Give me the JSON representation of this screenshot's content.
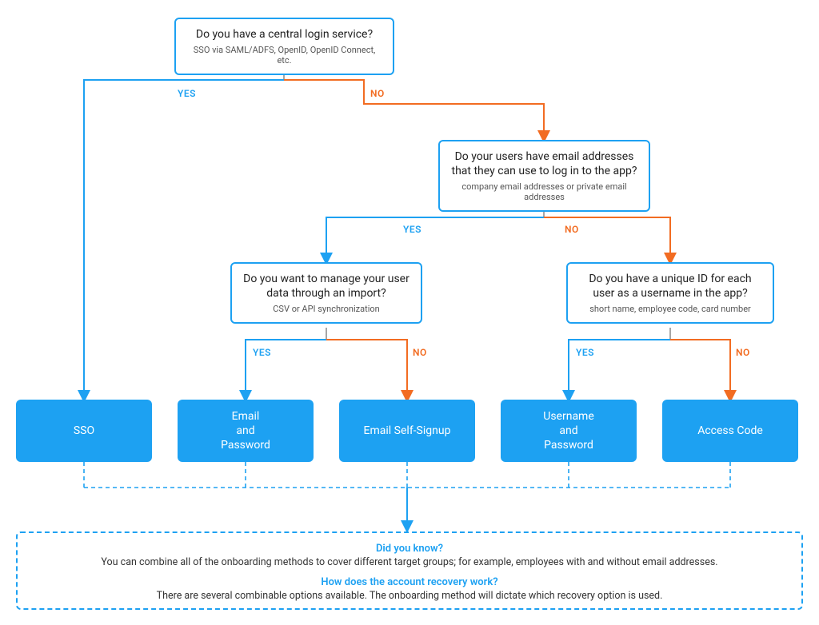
{
  "nodes": {
    "q1": {
      "question": "Do you have a central login service?",
      "sub": "SSO via SAML/ADFS, OpenID, OpenID Connect, etc."
    },
    "q2": {
      "question": "Do your users have email addresses that they can use to log in to the app?",
      "sub": "company email addresses or private email addresses"
    },
    "q3": {
      "question": "Do you want to manage your user data through an import?",
      "sub": "CSV or API synchronization"
    },
    "q4": {
      "question": "Do you have a unique ID for each user as a username in the app?",
      "sub": "short name, employee code, card number"
    }
  },
  "leaves": {
    "l1": "SSO",
    "l2": "Email\nand\nPassword",
    "l3": "Email Self-Signup",
    "l4": "Username\nand\nPassword",
    "l5": "Access Code"
  },
  "labels": {
    "yes": "YES",
    "no": "NO"
  },
  "info": {
    "h1": "Did you know?",
    "p1": "You can combine all of the onboarding methods to cover different target groups; for example, employees with and without email addresses.",
    "h2": "How does the account recovery work?",
    "p2": "There are several combinable options available. The onboarding method will dictate which recovery option is used."
  },
  "colors": {
    "blue": "#1DA1F2",
    "orange": "#F26C22"
  }
}
